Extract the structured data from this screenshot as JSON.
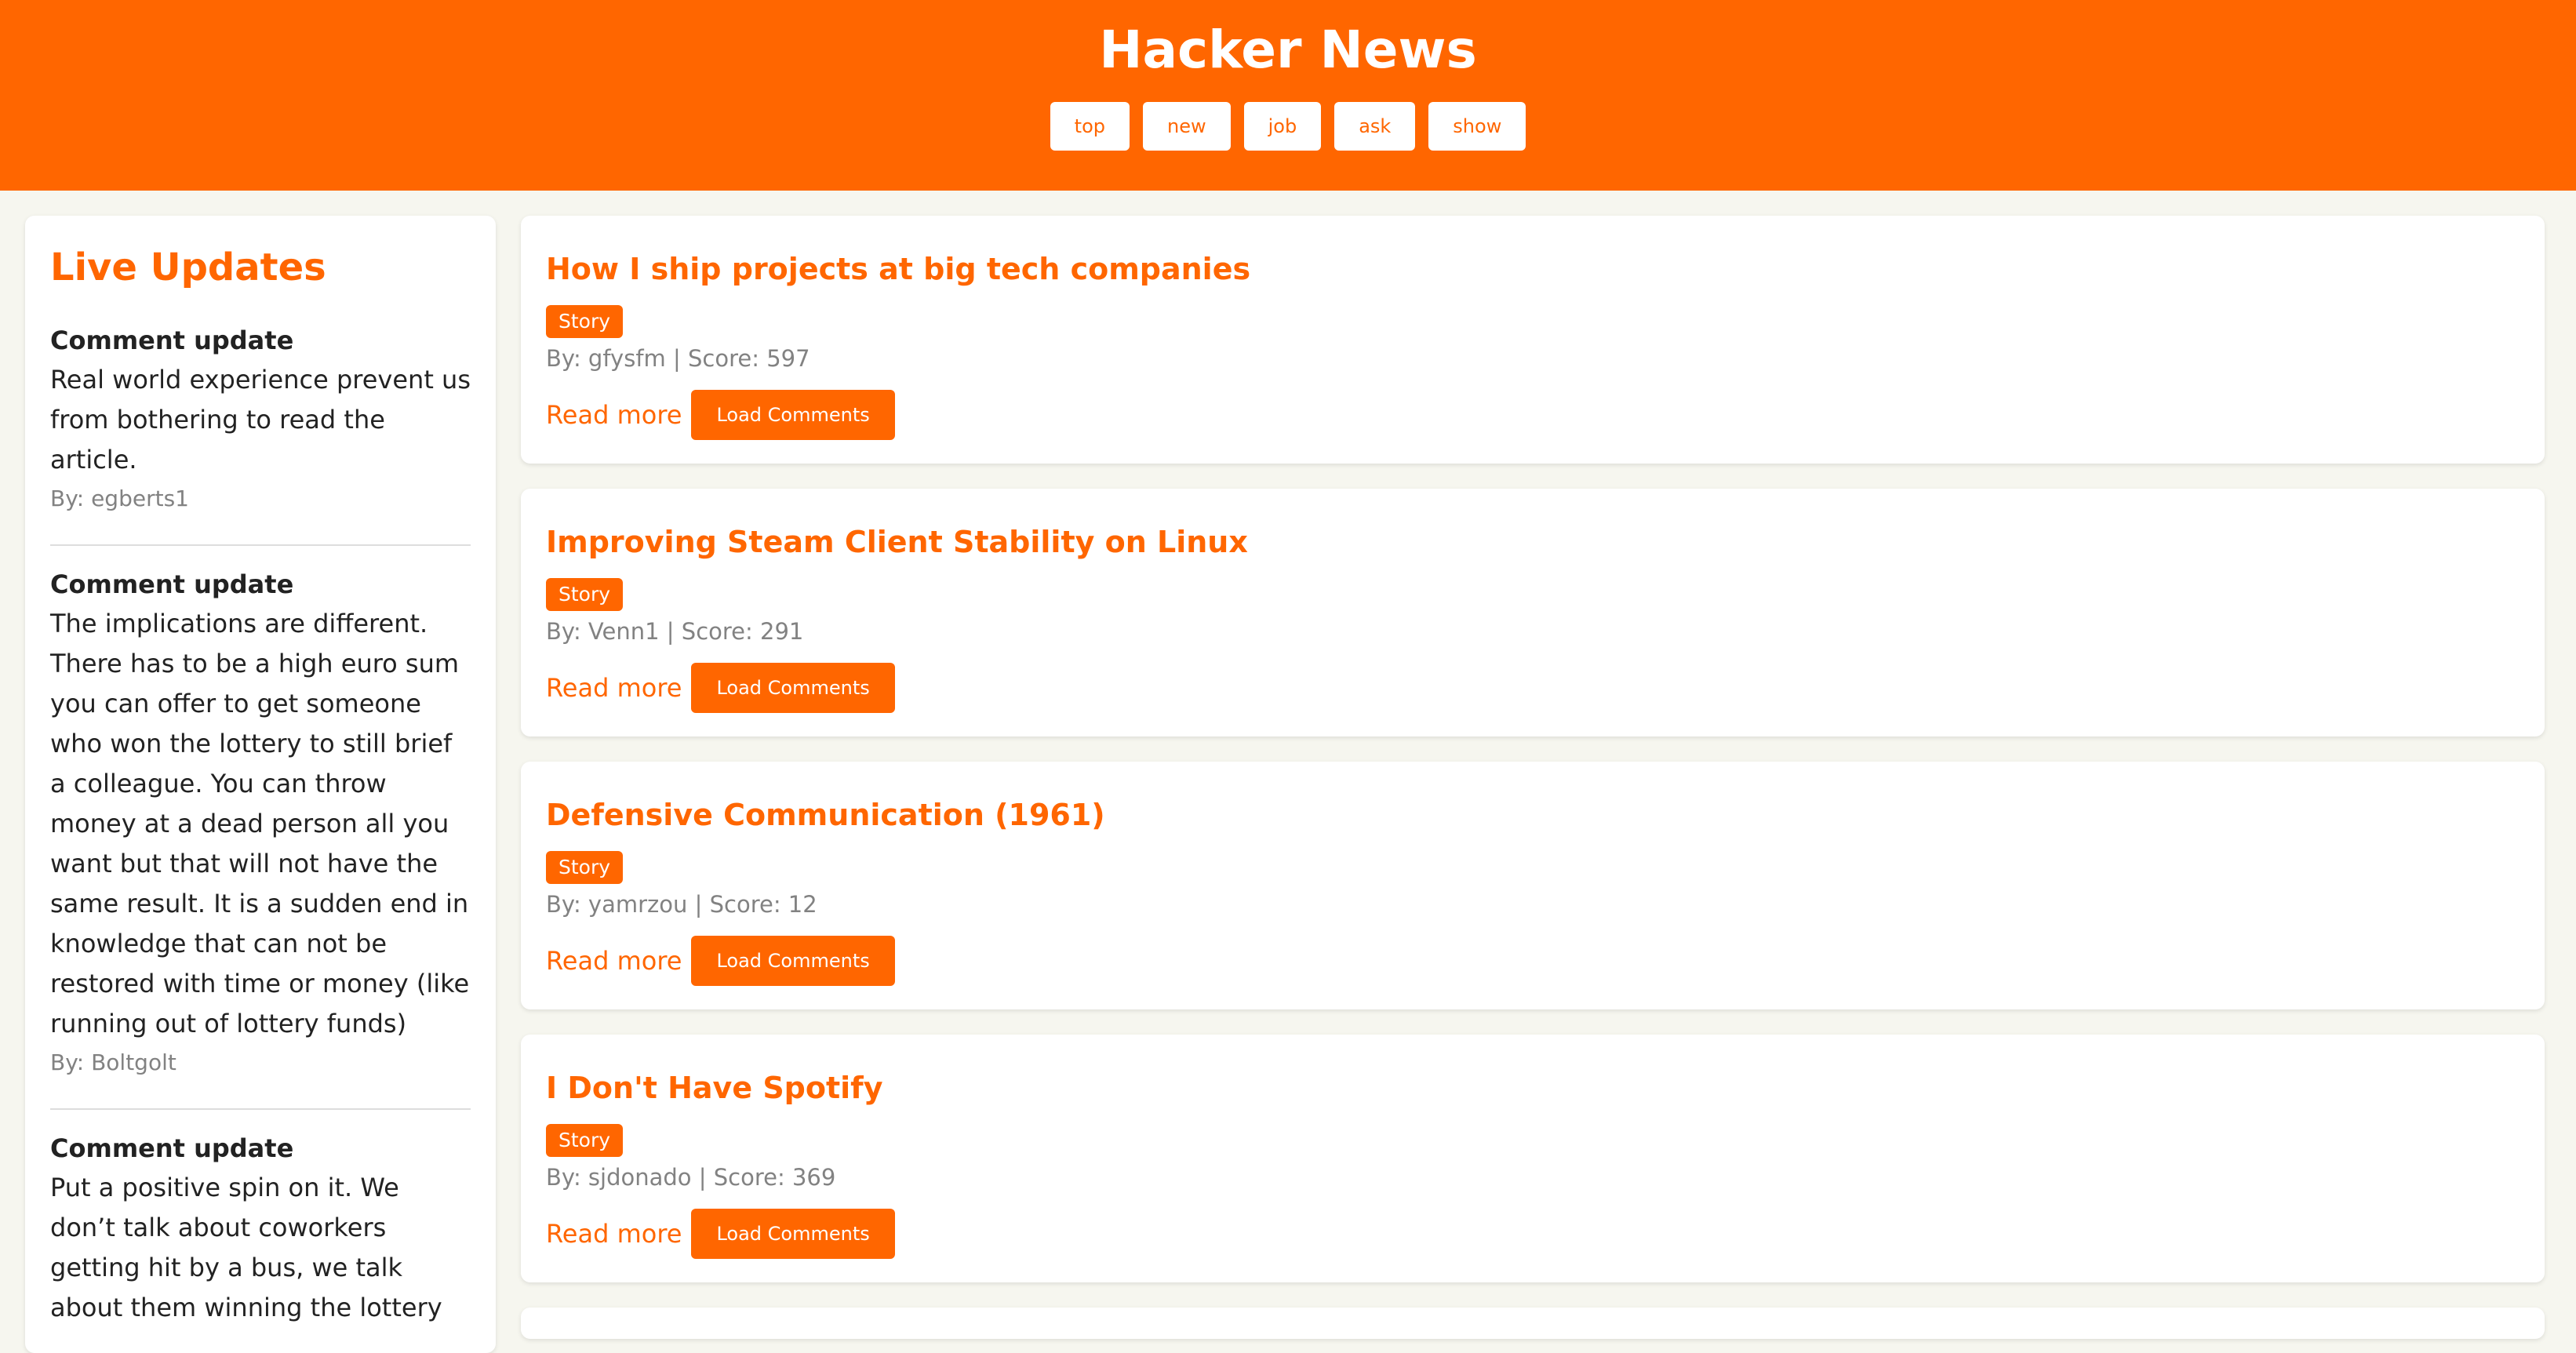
{
  "app": {
    "title": "Hacker News"
  },
  "nav": [
    {
      "label": "top"
    },
    {
      "label": "new"
    },
    {
      "label": "job"
    },
    {
      "label": "ask"
    },
    {
      "label": "show"
    }
  ],
  "sidebar": {
    "title": "Live Updates",
    "updates": [
      {
        "heading": "Comment update",
        "text": "Real world experience prevent us from bothering to read the article.",
        "author": "By: egberts1"
      },
      {
        "heading": "Comment update",
        "text": "The implications are different. There has to be a high euro sum you can offer to get someone who won the lottery to still brief a colleague. You can throw money at a dead person all you want but that will not have the same result. It is a sudden end in knowledge that can not be restored with time or money (like running out of lottery funds)",
        "author": "By: Boltgolt"
      },
      {
        "heading": "Comment update",
        "text": "Put a positive spin on it. We don’t talk about coworkers getting hit by a bus, we talk about them winning the lottery",
        "author": ""
      }
    ]
  },
  "stories": [
    {
      "title": "How I ship projects at big tech companies",
      "badge": "Story",
      "meta": "By: gfysfm | Score: 597",
      "read_more": "Read more",
      "load_comments": "Load Comments"
    },
    {
      "title": "Improving Steam Client Stability on Linux",
      "badge": "Story",
      "meta": "By: Venn1 | Score: 291",
      "read_more": "Read more",
      "load_comments": "Load Comments"
    },
    {
      "title": "Defensive Communication (1961)",
      "badge": "Story",
      "meta": "By: yamrzou | Score: 12",
      "read_more": "Read more",
      "load_comments": "Load Comments"
    },
    {
      "title": "I Don't Have Spotify",
      "badge": "Story",
      "meta": "By: sjdonado | Score: 369",
      "read_more": "Read more",
      "load_comments": "Load Comments"
    }
  ],
  "colors": {
    "accent": "#ff6600",
    "background": "#f6f6ef",
    "text": "#222222",
    "muted": "#828282"
  }
}
